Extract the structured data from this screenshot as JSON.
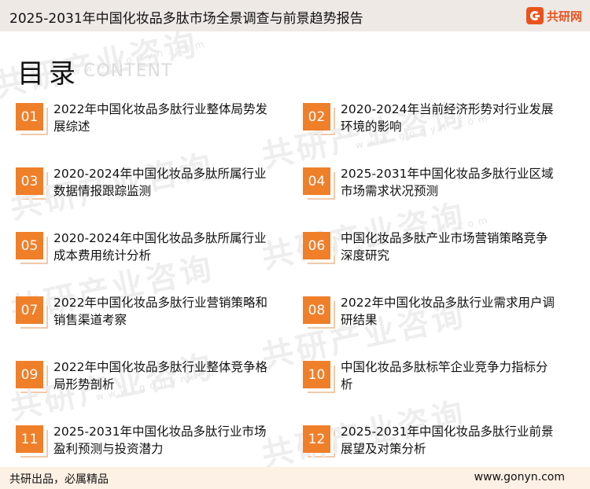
{
  "header": {
    "title": "2025-2031年中国化妆品多肽市场全景调查与前景趋势报告",
    "logo_text": "共研网",
    "brand_color": "#e8541c"
  },
  "watermark": {
    "text": "共研产业咨询",
    "site": "www.gonyn.com"
  },
  "toc": {
    "heading": "目录",
    "subheading": "CONTENT",
    "accent_color": "#f07f2a",
    "items": [
      {
        "num": "01",
        "label": "2022年中国化妆品多肽行业整体局势发展综述"
      },
      {
        "num": "02",
        "label": "2020-2024年当前经济形势对行业发展环境的影响"
      },
      {
        "num": "03",
        "label": "2020-2024年中国化妆品多肽所属行业数据情报跟踪监测"
      },
      {
        "num": "04",
        "label": "2025-2031年中国化妆品多肽行业区域市场需求状况预测"
      },
      {
        "num": "05",
        "label": "2020-2024年中国化妆品多肽所属行业成本费用统计分析"
      },
      {
        "num": "06",
        "label": "中国化妆品多肽产业市场营销策略竞争深度研究"
      },
      {
        "num": "07",
        "label": "2022年中国化妆品多肽行业营销策略和销售渠道考察"
      },
      {
        "num": "08",
        "label": "2022年中国化妆品多肽行业需求用户调研结果"
      },
      {
        "num": "09",
        "label": "2022年中国化妆品多肽行业整体竞争格局形势剖析"
      },
      {
        "num": "10",
        "label": "中国化妆品多肽标竿企业竞争力指标分析"
      },
      {
        "num": "11",
        "label": "2025-2031年中国化妆品多肽行业市场盈利预测与投资潜力"
      },
      {
        "num": "12",
        "label": "2025-2031年中国化妆品多肽行业前景展望及对策分析"
      }
    ]
  },
  "footer": {
    "slogan": "共研出品，必属精品",
    "site": "www.gonyn.com"
  }
}
